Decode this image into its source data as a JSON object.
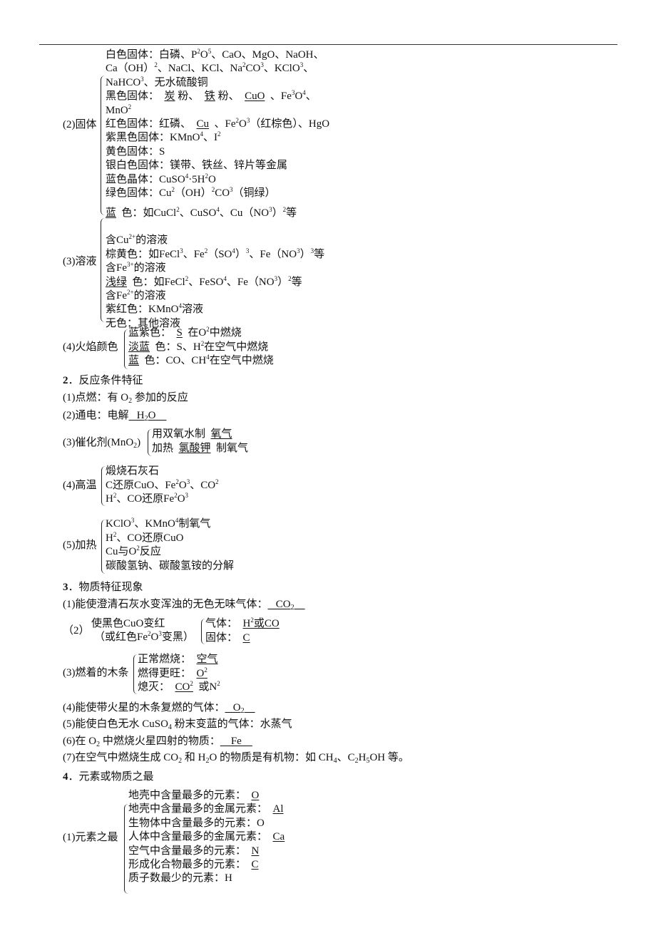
{
  "s1": {
    "solid": {
      "label": "(2)固体",
      "lines": [
        [
          "白色固体：白磷、P",
          {
            "sup": "2"
          },
          "O",
          {
            "sup": "5"
          },
          "、CaO、MgO、NaOH、"
        ],
        [
          "Ca（OH）",
          {
            "sup": "2"
          },
          "、NaCl、KCl、Na",
          {
            "sup": "2"
          },
          "CO",
          {
            "sup": "3"
          },
          "、KClO",
          {
            "sup": "3"
          },
          "、"
        ],
        [
          "NaHCO",
          {
            "sup": "3"
          },
          "、无水硫酸铜"
        ],
        [
          "黑色固体：  ",
          {
            "u": [
              "炭"
            ]
          },
          " 粉、  ",
          {
            "u": [
              "铁"
            ]
          },
          " 粉、  ",
          {
            "u": [
              "CuO"
            ]
          },
          "  、Fe",
          {
            "sup": "3"
          },
          "O",
          {
            "sup": "4"
          },
          "、"
        ],
        [
          "MnO",
          {
            "sup": "2"
          }
        ],
        [
          "红色固体：红磷、  ",
          {
            "u": [
              "Cu"
            ]
          },
          "  、Fe",
          {
            "sup": "2"
          },
          "O",
          {
            "sup": "3"
          },
          "（红棕色）、HgO"
        ],
        [
          "紫黑色固体：KMnO",
          {
            "sup": "4"
          },
          "、I",
          {
            "sup": "2"
          }
        ],
        [
          "黄色固体：S"
        ],
        [
          "银白色固体：镁带、铁丝、锌片等金属"
        ],
        [
          "蓝色晶体：CuSO",
          {
            "sup": "4"
          },
          "·5H",
          {
            "sup": "2"
          },
          "O"
        ],
        [
          "绿色固体：Cu",
          {
            "sup": "2"
          },
          "（OH）",
          {
            "sup": "2"
          },
          "CO",
          {
            "sup": "3"
          },
          "（铜绿）"
        ]
      ]
    },
    "solution": {
      "label": "(3)溶液",
      "lines": [
        [
          {
            "u": [
              "蓝"
            ]
          },
          "  色：如CuCl",
          {
            "sup": "2"
          },
          "、CuSO",
          {
            "sup": "4"
          },
          "、Cu（NO",
          {
            "sup": "3"
          },
          "）",
          {
            "sup": "2"
          },
          "等"
        ],
        [
          "含Cu",
          {
            "sup": "2+"
          },
          "的溶液"
        ],
        [
          "棕黄色：如FeCl",
          {
            "sup": "3"
          },
          "、Fe",
          {
            "sup": "2"
          },
          "（SO",
          {
            "sup": "4"
          },
          "）",
          {
            "sup": "3"
          },
          "、Fe（NO",
          {
            "sup": "3"
          },
          "）",
          {
            "sup": "3"
          },
          "等"
        ],
        [
          "含Fe",
          {
            "sup": "3+"
          },
          "的溶液"
        ],
        [
          {
            "u": [
              "浅绿"
            ]
          },
          "  色：如FeCl",
          {
            "sup": "2"
          },
          "、FeSO",
          {
            "sup": "4"
          },
          "、Fe（NO",
          {
            "sup": "3"
          },
          "）",
          {
            "sup": "2"
          },
          "等"
        ],
        [
          "含Fe",
          {
            "sup": "2+"
          },
          "的溶液"
        ],
        [
          "紫红色：KMnO",
          {
            "sup": "4"
          },
          "溶液"
        ],
        [
          "无色：其他溶液"
        ]
      ]
    },
    "flame": {
      "label": "(4)火焰颜色",
      "lines": [
        [
          "蓝紫色：  ",
          {
            "u": [
              "S"
            ]
          },
          "  在O",
          {
            "sup": "2"
          },
          "中燃烧"
        ],
        [
          {
            "u": [
              "淡蓝"
            ]
          },
          "  色：S、H",
          {
            "sup": "2"
          },
          "在空气中燃烧"
        ],
        [
          {
            "u": [
              "蓝"
            ]
          },
          "  色：CO、CH",
          {
            "sup": "4"
          },
          "在空气中燃烧"
        ]
      ]
    }
  },
  "s2": {
    "heading": [
      {
        "b": "2"
      },
      "．反应条件特征"
    ],
    "ignite": [
      "(1)点燃：有 O",
      {
        "sub": "2"
      },
      " 参加的反应"
    ],
    "electric": [
      "(2)通电：电解",
      {
        "u": [
          "   H",
          {
            "sub": "2"
          },
          "O    "
        ]
      }
    ],
    "catalyst": {
      "label": [
        "(3)催化剂(MnO",
        {
          "sub": "2"
        },
        ")"
      ],
      "lines": [
        [
          "用双氧水制  ",
          {
            "u": [
              "氧气"
            ]
          }
        ],
        [
          "加热  ",
          {
            "u": [
              "氯酸钾"
            ]
          },
          "  制氧气"
        ]
      ]
    },
    "hightemp": {
      "label": [
        "(4)高温"
      ],
      "lines": [
        [
          "煅烧石灰石"
        ],
        [
          "C还原CuO、Fe",
          {
            "sup": "2"
          },
          "O",
          {
            "sup": "3"
          },
          "、CO",
          {
            "sup": "2"
          }
        ],
        [
          "H",
          {
            "sup": "2"
          },
          "、CO还原Fe",
          {
            "sup": "2"
          },
          "O",
          {
            "sup": "3"
          }
        ]
      ]
    },
    "heat": {
      "label": [
        "(5)加热"
      ],
      "lines": [
        [
          "KClO",
          {
            "sup": "3"
          },
          "、KMnO",
          {
            "sup": "4"
          },
          "制氧气"
        ],
        [
          "H",
          {
            "sup": "2"
          },
          "、CO还原CuO"
        ],
        [
          "Cu与O",
          {
            "sup": "2"
          },
          "反应"
        ],
        [
          "碳酸氢钠、碳酸氢铵的分解"
        ]
      ]
    }
  },
  "s3": {
    "heading": [
      {
        "b": "3"
      },
      "．物质特征现象"
    ],
    "q1": [
      "(1)能使澄清石灰水变浑浊的无色无味气体：",
      {
        "u": [
          "   CO",
          {
            "sub": "2"
          },
          "    "
        ]
      }
    ],
    "q2": {
      "num": [
        "（2）"
      ],
      "cond1": [
        "使黑色CuO变红"
      ],
      "cond2": [
        "（或红色Fe",
        {
          "sup": "2"
        },
        "O",
        {
          "sup": "3"
        },
        "变黑）"
      ],
      "lines": [
        [
          "气体：  ",
          {
            "u": [
              "H",
              {
                "sup": "2"
              },
              "或CO"
            ]
          }
        ],
        [
          "固体：  ",
          {
            "u": [
              "C"
            ]
          }
        ]
      ]
    },
    "q3": {
      "label": [
        "(3)燃着的木条"
      ],
      "lines": [
        [
          "正常燃烧：  ",
          {
            "u": [
              "空气"
            ]
          }
        ],
        [
          "燃得更旺：  ",
          {
            "u": [
              "O",
              {
                "sup": "2"
              }
            ]
          }
        ],
        [
          "熄灭：  ",
          {
            "u": [
              "CO",
              {
                "sup": "2"
              }
            ]
          },
          "  或N",
          {
            "sup": "2"
          }
        ]
      ]
    },
    "q4": [
      "(4)能使带火星的木条复燃的气体：",
      {
        "u": [
          "   O",
          {
            "sub": "2"
          },
          "    "
        ]
      }
    ],
    "q5": [
      "(5)能使白色无水 CuSO",
      {
        "sub": "4"
      },
      " 粉末变蓝的气体：水蒸气"
    ],
    "q6": [
      "(6)在 O",
      {
        "sub": "2"
      },
      " 中燃烧火星四射的物质：",
      {
        "u": [
          "    Fe    "
        ]
      }
    ],
    "q7": [
      "(7)在空气中燃烧生成 CO",
      {
        "sub": "2"
      },
      " 和 H",
      {
        "sub": "2"
      },
      "O 的物质是有机物：如 CH",
      {
        "sub": "4"
      },
      "、C",
      {
        "sub": "2"
      },
      "H",
      {
        "sub": "5"
      },
      "OH 等。"
    ]
  },
  "s4": {
    "heading": [
      {
        "b": "4"
      },
      "．元素或物质之最"
    ],
    "elements": {
      "label": [
        "(1)元素之最"
      ],
      "lines": [
        [
          "地壳中含量最多的元素：  ",
          {
            "u": [
              "O"
            ]
          }
        ],
        [
          "地壳中含量最多的金属元素：  ",
          {
            "u": [
              "Al"
            ]
          }
        ],
        [
          "生物体中含量最多的元素：O"
        ],
        [
          "人体中含量最多的金属元素：  ",
          {
            "u": [
              "Ca"
            ]
          }
        ],
        [
          "空气中含量最多的元素：  ",
          {
            "u": [
              "N"
            ]
          }
        ],
        [
          "形成化合物最多的元素：  ",
          {
            "u": [
              "C"
            ]
          }
        ],
        [
          "质子数最少的元素：H"
        ]
      ]
    }
  }
}
